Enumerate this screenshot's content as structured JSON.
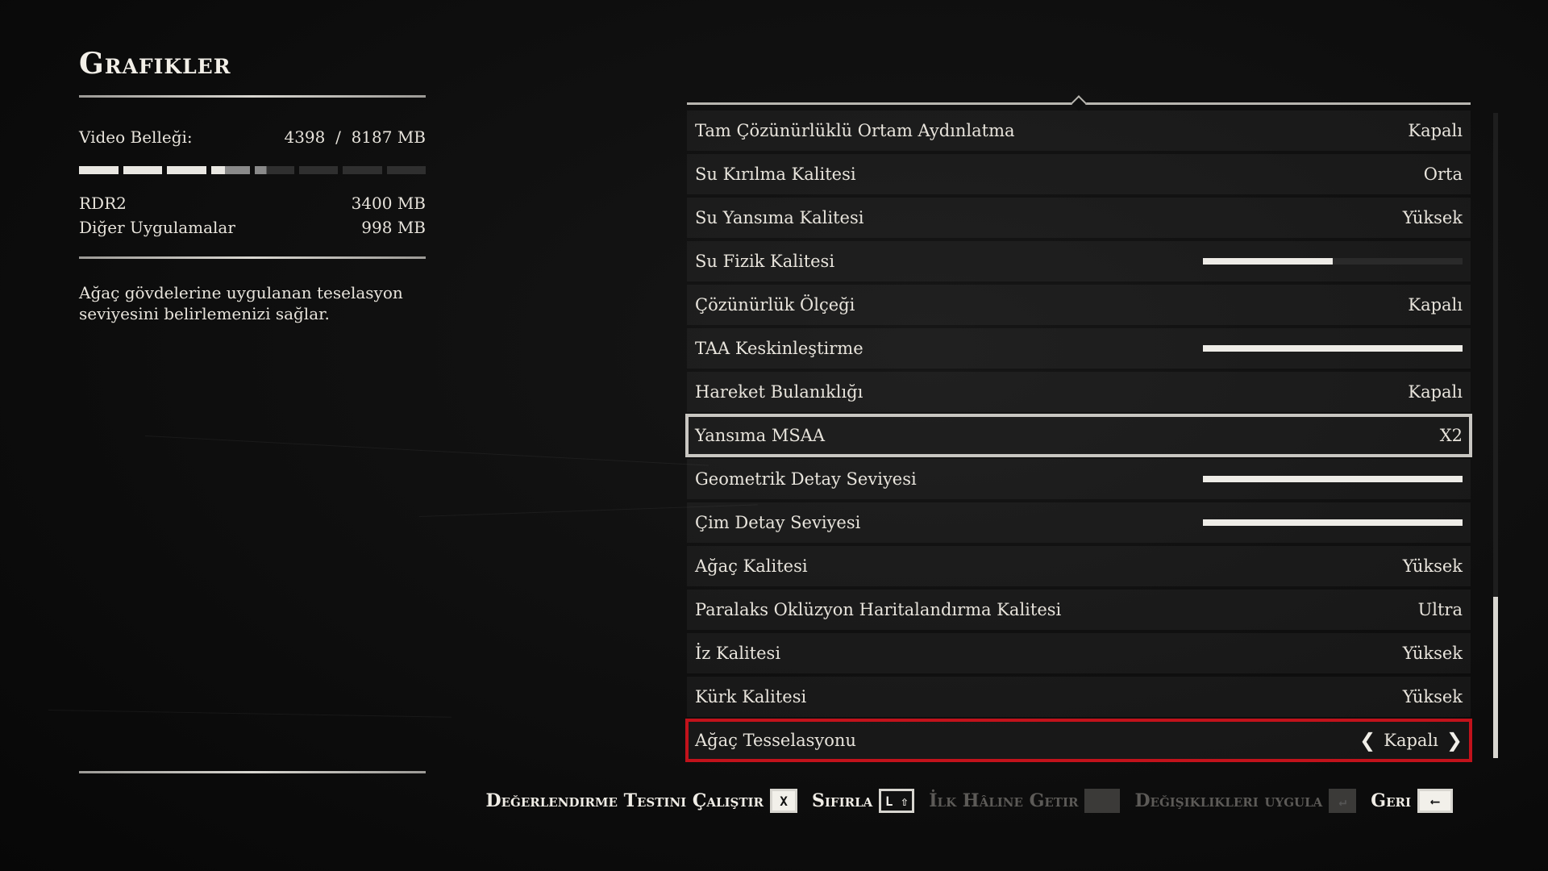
{
  "page": {
    "title": "Grafikler"
  },
  "memory": {
    "video_label": "Video Belleği:",
    "video_used": "4398",
    "separator": "/",
    "video_total": "8187 MB",
    "usage_fraction": 0.54,
    "rdr2_label": "RDR2",
    "rdr2_value": "3400 MB",
    "other_label": "Diğer Uygulamalar",
    "other_value": "998 MB"
  },
  "description": "Ağaç gövdelerine uygulanan teselasyon seviyesini belirlemenizi sağlar.",
  "settings": [
    {
      "label": "Tam Çözünürlüklü Ortam Aydınlatma",
      "value": "Kapalı"
    },
    {
      "label": "Su Kırılma Kalitesi",
      "value": "Orta"
    },
    {
      "label": "Su Yansıma Kalitesi",
      "value": "Yüksek"
    },
    {
      "label": "Su Fizik Kalitesi",
      "slider": 0.5
    },
    {
      "label": "Çözünürlük Ölçeği",
      "value": "Kapalı"
    },
    {
      "label": "TAA Keskinleştirme",
      "slider": 1.0
    },
    {
      "label": "Hareket Bulanıklığı",
      "value": "Kapalı"
    },
    {
      "label": "Yansıma MSAA",
      "value": "X2"
    },
    {
      "label": "Geometrik Detay Seviyesi",
      "slider": 1.0
    },
    {
      "label": "Çim Detay Seviyesi",
      "slider": 1.0
    },
    {
      "label": "Ağaç Kalitesi",
      "value": "Yüksek"
    },
    {
      "label": "Paralaks Oklüzyon Haritalandırma Kalitesi",
      "value": "Ultra"
    },
    {
      "label": "İz Kalitesi",
      "value": "Yüksek"
    },
    {
      "label": "Kürk Kalitesi",
      "value": "Yüksek"
    },
    {
      "label": "Ağaç Tesselasyonu",
      "value": "Kapalı"
    }
  ],
  "actions": {
    "benchmark_label": "Değerlendirme Testini Çalıştır",
    "benchmark_key": "X",
    "reset_label": "Sıfırla",
    "reset_key": "L ⇧",
    "restore_label": "İlk Hâline Getir",
    "apply_label": "Değişiklikleri uygula",
    "apply_key": "↵",
    "back_label": "Geri",
    "back_key": "⟵"
  },
  "colors": {
    "accent_red": "#c2121b",
    "highlight": "#c9c7c2",
    "text": "#e8e4dc"
  },
  "icons": {
    "left": "chevron-left-icon",
    "right": "chevron-right-icon"
  }
}
